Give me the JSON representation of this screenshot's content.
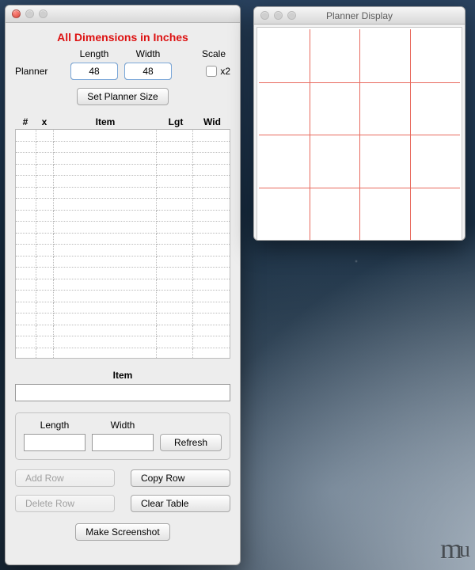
{
  "main_window": {
    "header": "All Dimensions in Inches",
    "labels": {
      "length": "Length",
      "width": "Width",
      "scale": "Scale",
      "planner": "Planner",
      "x2": "x2"
    },
    "planner": {
      "length": "48",
      "width": "48",
      "scale_x2": false
    },
    "set_size_btn": "Set Planner Size",
    "table": {
      "headers": {
        "num": "#",
        "x": "x",
        "item": "Item",
        "lgt": "Lgt",
        "wid": "Wid"
      },
      "rows": 20
    },
    "item_label": "Item",
    "item_value": "",
    "lw": {
      "length_label": "Length",
      "width_label": "Width",
      "length": "",
      "width": ""
    },
    "buttons": {
      "refresh": "Refresh",
      "add_row": "Add Row",
      "copy_row": "Copy Row",
      "delete_row": "Delete Row",
      "clear_table": "Clear Table",
      "screenshot": "Make Screenshot"
    }
  },
  "display_window": {
    "title": "Planner Display",
    "grid": {
      "cols": 4,
      "rows": 4
    }
  },
  "watermark": "mu"
}
